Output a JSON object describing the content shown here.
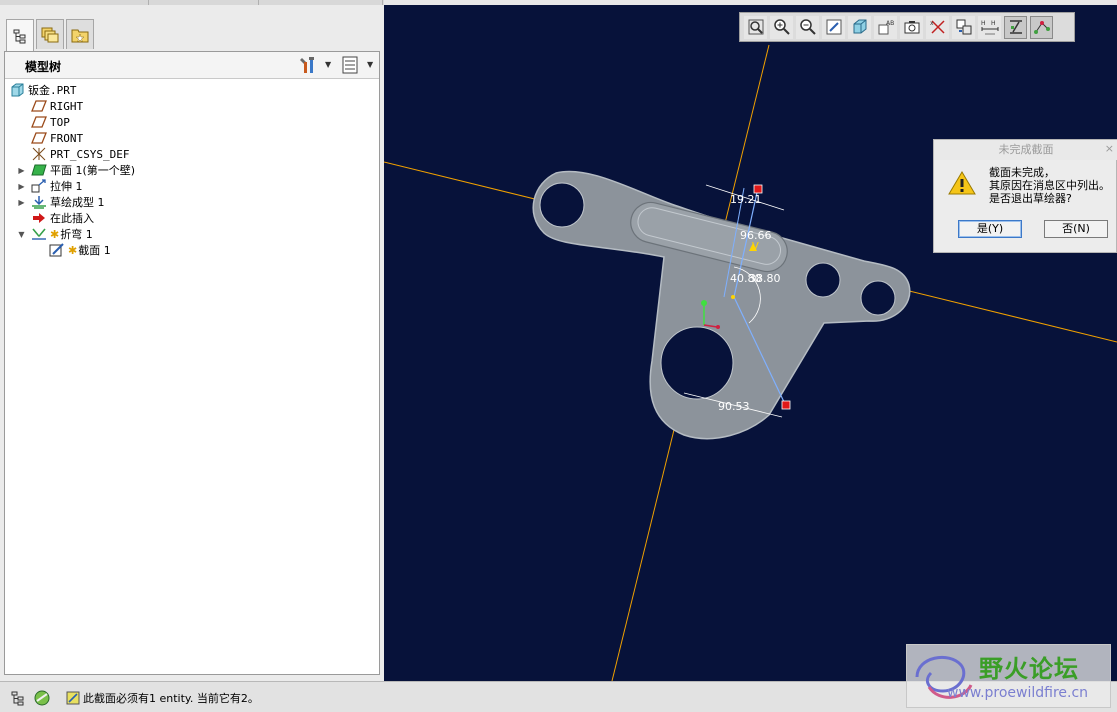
{
  "model_tree": {
    "title": "模型树",
    "tabs": [
      "model-tree-tab",
      "layers-tab",
      "favorites-tab"
    ],
    "items": [
      {
        "label": "钣金.PRT",
        "icon": "part-icon",
        "level": 0,
        "expander": ""
      },
      {
        "label": "RIGHT",
        "icon": "datum-plane-icon",
        "level": 1,
        "expander": ""
      },
      {
        "label": "TOP",
        "icon": "datum-plane-icon",
        "level": 1,
        "expander": ""
      },
      {
        "label": "FRONT",
        "icon": "datum-plane-icon",
        "level": 1,
        "expander": ""
      },
      {
        "label": "PRT_CSYS_DEF",
        "icon": "csys-icon",
        "level": 1,
        "expander": ""
      },
      {
        "label": "平面 1(第一个壁)",
        "icon": "flat-wall-icon",
        "level": 1,
        "expander": "▶"
      },
      {
        "label": "拉伸 1",
        "icon": "extrude-icon",
        "level": 1,
        "expander": "▶"
      },
      {
        "label": "草绘成型 1",
        "icon": "sketch-form-icon",
        "level": 1,
        "expander": "▶"
      },
      {
        "label": "在此插入",
        "icon": "insert-here-icon",
        "level": 1,
        "expander": ""
      },
      {
        "label": "折弯 1",
        "icon": "bend-icon",
        "level": 1,
        "expander": "▼"
      },
      {
        "label": "截面 1",
        "icon": "section-icon",
        "level": 2,
        "expander": ""
      }
    ]
  },
  "sketch": {
    "dimensions": [
      "19.21",
      "96.66",
      "40.80",
      "38.80",
      "90.53"
    ]
  },
  "dialog": {
    "title": "未完成截面",
    "close": "×",
    "lines": [
      "截面未完成，",
      "其原因在消息区中列出。",
      "是否退出草绘器?"
    ],
    "yes_label": "是(Y)",
    "no_label": "否(N)"
  },
  "status": {
    "message": "此截面必须有1 entity. 当前它有2。"
  },
  "watermark": {
    "brand": "野火论坛",
    "url": "www.proewildfire.cn"
  },
  "colors": {
    "viewport_bg": "#07123a",
    "part": "#8c939b",
    "datum_axis": "#f0a000",
    "sketch_line": "#7fb0ff",
    "dim_text": "#ffffff"
  }
}
